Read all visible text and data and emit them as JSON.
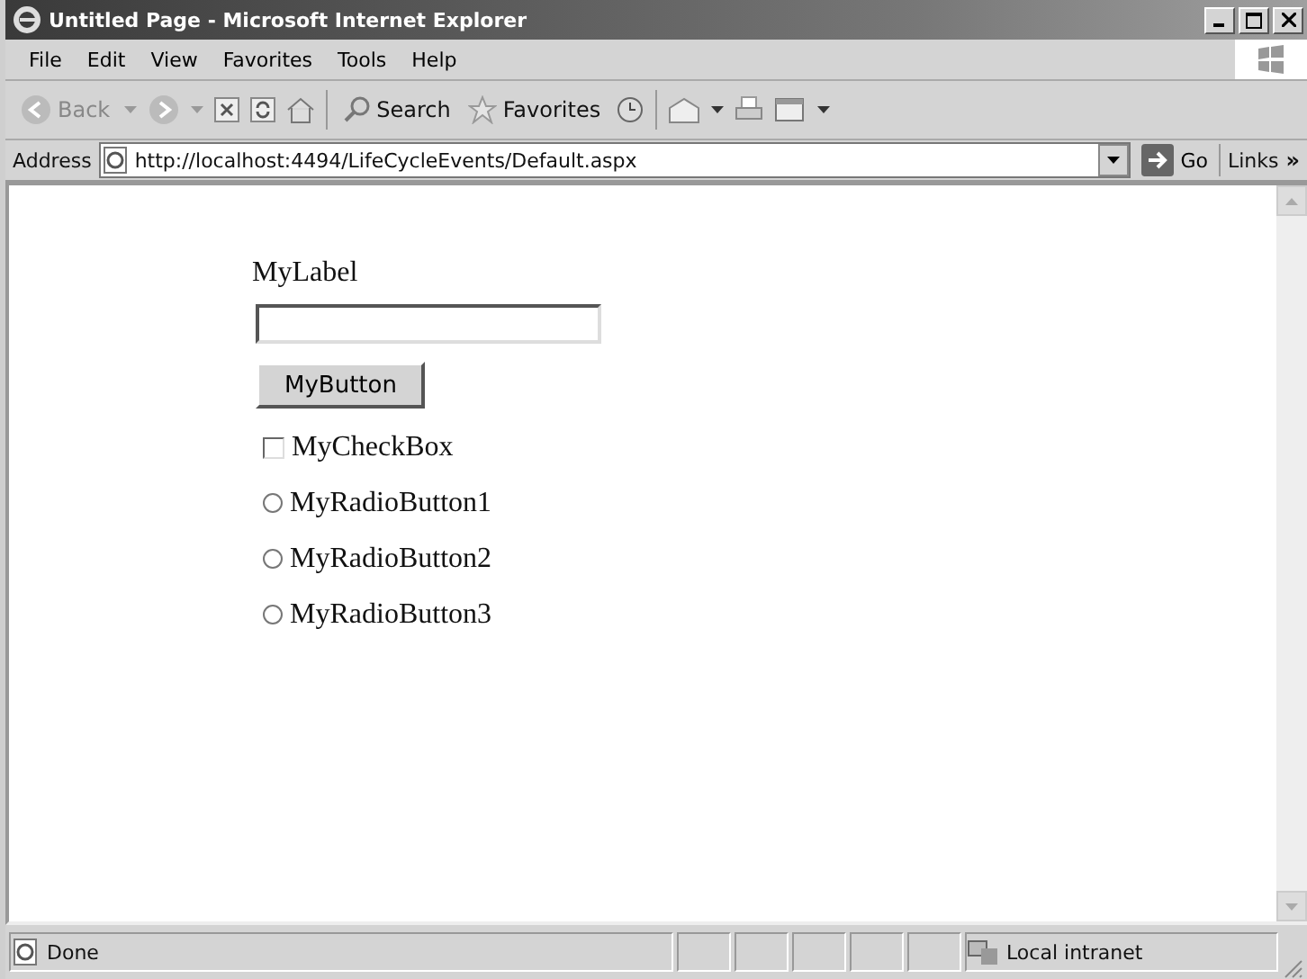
{
  "window": {
    "title": "Untitled Page - Microsoft Internet Explorer"
  },
  "menu": [
    "File",
    "Edit",
    "View",
    "Favorites",
    "Tools",
    "Help"
  ],
  "toolbar": {
    "back": "Back",
    "search": "Search",
    "favorites": "Favorites",
    "back_disabled": true
  },
  "address": {
    "label": "Address",
    "url": "http://localhost:4494/LifeCycleEvents/Default.aspx",
    "go": "Go",
    "links": "Links",
    "more": "»"
  },
  "page": {
    "label": "MyLabel",
    "button": "MyButton",
    "checkbox": {
      "label": "MyCheckBox",
      "checked": false
    },
    "radios": [
      {
        "label": "MyRadioButton1",
        "selected": false
      },
      {
        "label": "MyRadioButton2",
        "selected": false
      },
      {
        "label": "MyRadioButton3",
        "selected": false
      }
    ]
  },
  "status_bar": {
    "text": "Done",
    "zone": "Local intranet"
  }
}
